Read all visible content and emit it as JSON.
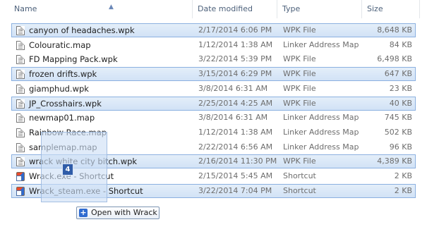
{
  "header": {
    "name": "Name",
    "date_modified": "Date modified",
    "type": "Type",
    "size": "Size"
  },
  "rows": [
    {
      "name": "canyon of headaches.wpk",
      "date": "2/17/2014 6:06 PM",
      "type": "WPK File",
      "size": "8,648 KB",
      "selected": true,
      "icon": "file-icon"
    },
    {
      "name": "Colouratic.map",
      "date": "1/12/2014 1:38 AM",
      "type": "Linker Address Map",
      "size": "84 KB",
      "selected": false,
      "icon": "file-icon"
    },
    {
      "name": "FD Mapping Pack.wpk",
      "date": "3/22/2014 5:39 PM",
      "type": "WPK File",
      "size": "6,498 KB",
      "selected": false,
      "icon": "file-icon"
    },
    {
      "name": "frozen drifts.wpk",
      "date": "3/15/2014 6:29 PM",
      "type": "WPK File",
      "size": "647 KB",
      "selected": true,
      "icon": "file-icon"
    },
    {
      "name": "giamphud.wpk",
      "date": "3/8/2014 6:31 AM",
      "type": "WPK File",
      "size": "23 KB",
      "selected": false,
      "icon": "file-icon"
    },
    {
      "name": "JP_Crosshairs.wpk",
      "date": "2/25/2014 4:25 AM",
      "type": "WPK File",
      "size": "40 KB",
      "selected": true,
      "icon": "file-icon"
    },
    {
      "name": "newmap01.map",
      "date": "3/8/2014 6:31 AM",
      "type": "Linker Address Map",
      "size": "745 KB",
      "selected": false,
      "icon": "file-icon"
    },
    {
      "name": "Rainbow Race.map",
      "date": "1/12/2014 1:38 AM",
      "type": "Linker Address Map",
      "size": "502 KB",
      "selected": false,
      "icon": "file-icon"
    },
    {
      "name": "samplemap.map",
      "date": "2/22/2014 6:56 AM",
      "type": "Linker Address Map",
      "size": "96 KB",
      "selected": false,
      "icon": "file-icon"
    },
    {
      "name": "wrack white city bitch.wpk",
      "date": "2/16/2014 11:30 PM",
      "type": "WPK File",
      "size": "4,389 KB",
      "selected": true,
      "icon": "file-icon"
    },
    {
      "name": "Wrack.exe - Shortcut",
      "date": "2/15/2014 5:45 AM",
      "type": "Shortcut",
      "size": "2 KB",
      "selected": false,
      "icon": "shortcut-icon"
    },
    {
      "name": "Wrack_steam.exe - Shortcut",
      "date": "3/22/2014 7:04 PM",
      "type": "Shortcut",
      "size": "2 KB",
      "selected": true,
      "icon": "shortcut-icon"
    }
  ],
  "drag": {
    "count": "4",
    "tooltip": "Open with Wrack"
  },
  "colors": {
    "selection": "#d2e2f6",
    "selection_border": "#8bb0e0",
    "header_text": "#4c607a"
  }
}
